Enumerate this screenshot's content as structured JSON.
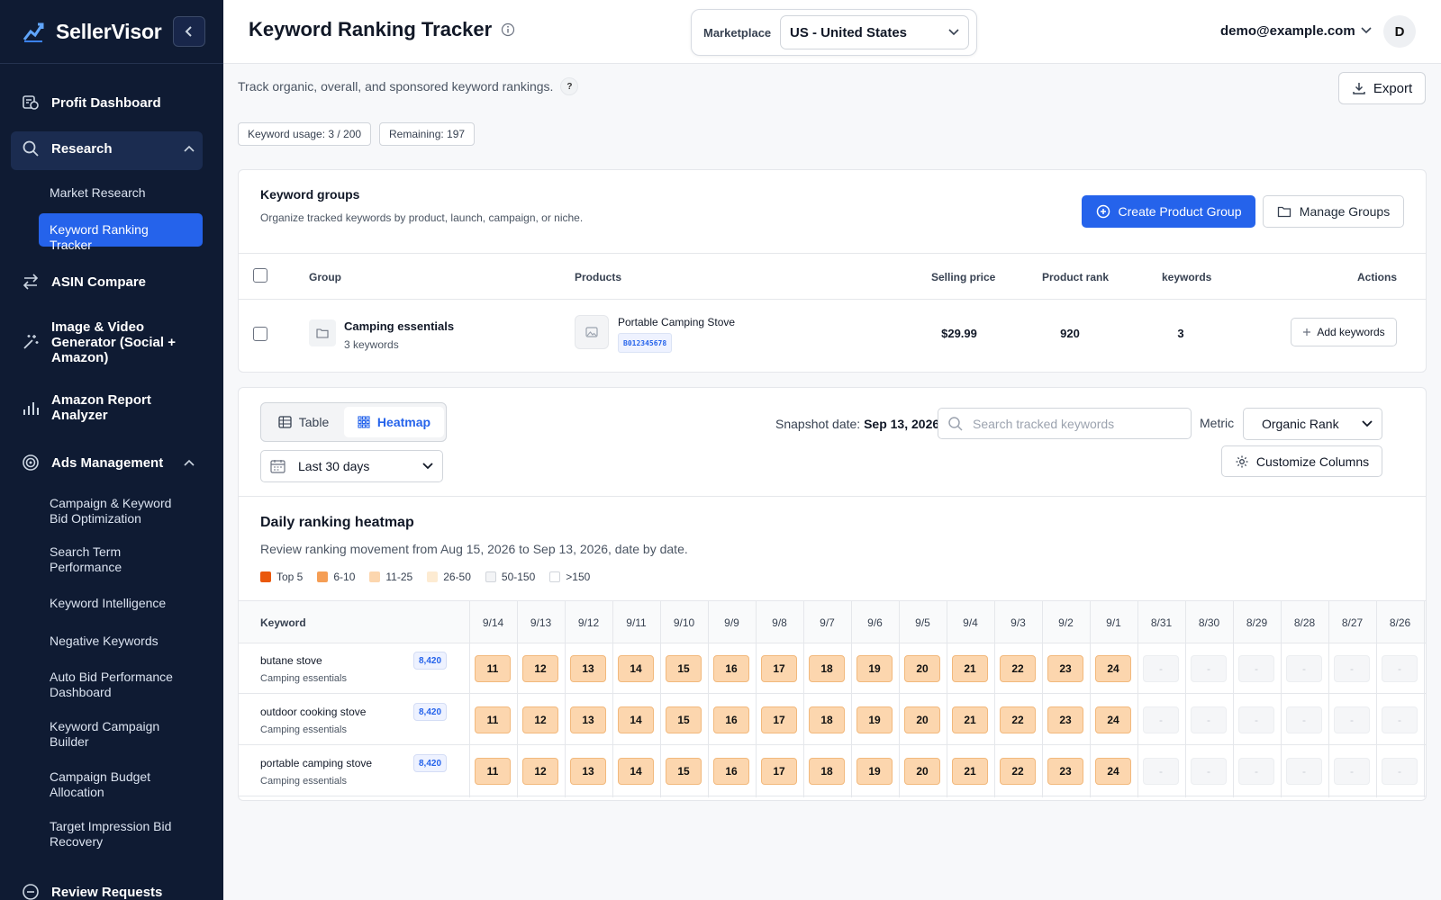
{
  "brand": {
    "name": "SellerVisor"
  },
  "sidebar": {
    "items": [
      {
        "label": "Profit Dashboard",
        "icon": "dollar-dashboard-icon"
      },
      {
        "label": "Research",
        "icon": "search-icon",
        "expanded": true
      },
      {
        "label": "Market Research",
        "sub": true
      },
      {
        "label": "Keyword Ranking Tracker",
        "sub": true,
        "active": true
      },
      {
        "label": "ASIN Compare",
        "icon": "arrows-compare-icon"
      },
      {
        "label": "Image & Video Generator (Social + Amazon)",
        "icon": "sparkle-icon"
      },
      {
        "label": "Amazon Report Analyzer",
        "icon": "bar-chart-icon"
      },
      {
        "label": "Ads Management",
        "icon": "target-icon",
        "expanded": true
      },
      {
        "label": "Campaign & Keyword Bid Optimization",
        "sub": true
      },
      {
        "label": "Search Term Performance",
        "sub": true
      },
      {
        "label": "Keyword Intelligence",
        "sub": true
      },
      {
        "label": "Negative Keywords",
        "sub": true
      },
      {
        "label": "Auto Bid Performance Dashboard",
        "sub": true
      },
      {
        "label": "Keyword Campaign Builder",
        "sub": true
      },
      {
        "label": "Campaign Budget Allocation",
        "sub": true
      },
      {
        "label": "Target Impression Bid Recovery",
        "sub": true
      },
      {
        "label": "Review Requests",
        "icon": "chat-icon"
      }
    ]
  },
  "header": {
    "title": "Keyword Ranking Tracker",
    "marketplace_label": "Marketplace",
    "marketplace_value": "US - United States",
    "user_email": "demo@example.com",
    "avatar_initial": "D"
  },
  "page": {
    "subtitle": "Track organic, overall, and sponsored keyword rankings.",
    "help": "?",
    "export_label": "Export",
    "usage_chip": "Keyword usage: 3 / 200",
    "remaining_chip": "Remaining: 197"
  },
  "groups": {
    "title": "Keyword groups",
    "description": "Organize tracked keywords by product, launch, campaign, or niche.",
    "create_label": "Create Product Group",
    "manage_label": "Manage Groups",
    "columns": {
      "group": "Group",
      "products": "Products",
      "price": "Selling price",
      "rank": "Product rank",
      "keywords": "keywords",
      "actions": "Actions"
    },
    "row": {
      "name": "Camping essentials",
      "count": "3 keywords",
      "product": "Portable Camping Stove",
      "asin": "B012345678",
      "price": "$29.99",
      "rank": "920",
      "keywords": "3",
      "action": "Add keywords"
    }
  },
  "heatmap": {
    "view_table": "Table",
    "view_heatmap": "Heatmap",
    "range": "Last 30 days",
    "snapshot_label": "Snapshot date:",
    "snapshot_value": "Sep 13, 2026",
    "search_placeholder": "Search tracked keywords",
    "metric_label": "Metric",
    "metric_value": "Organic Rank",
    "customize_label": "Customize Columns",
    "title": "Daily ranking heatmap",
    "description": "Review ranking movement from Aug 15, 2026 to Sep 13, 2026, date by date.",
    "legend": [
      {
        "label": "Top 5",
        "color": "#ea580c"
      },
      {
        "label": "6-10",
        "color": "#f59e55"
      },
      {
        "label": "11-25",
        "color": "#fcd6ae"
      },
      {
        "label": "26-50",
        "color": "#fdebd2"
      },
      {
        "label": "50-150",
        "color": "#f3f4f6"
      },
      {
        "label": ">150",
        "color": "#ffffff"
      }
    ],
    "keyword_col": "Keyword",
    "dates": [
      "9/14",
      "9/13",
      "9/12",
      "9/11",
      "9/10",
      "9/9",
      "9/8",
      "9/7",
      "9/6",
      "9/5",
      "9/4",
      "9/3",
      "9/2",
      "9/1",
      "8/31",
      "8/30",
      "8/29",
      "8/28",
      "8/27",
      "8/26"
    ],
    "rows": [
      {
        "keyword": "butane stove",
        "group": "Camping essentials",
        "volume": "8,420",
        "ranks": [
          "11",
          "12",
          "13",
          "14",
          "15",
          "16",
          "17",
          "18",
          "19",
          "20",
          "21",
          "22",
          "23",
          "24",
          "-",
          "-",
          "-",
          "-",
          "-",
          "-"
        ]
      },
      {
        "keyword": "outdoor cooking stove",
        "group": "Camping essentials",
        "volume": "8,420",
        "ranks": [
          "11",
          "12",
          "13",
          "14",
          "15",
          "16",
          "17",
          "18",
          "19",
          "20",
          "21",
          "22",
          "23",
          "24",
          "-",
          "-",
          "-",
          "-",
          "-",
          "-"
        ]
      },
      {
        "keyword": "portable camping stove",
        "group": "Camping essentials",
        "volume": "8,420",
        "ranks": [
          "11",
          "12",
          "13",
          "14",
          "15",
          "16",
          "17",
          "18",
          "19",
          "20",
          "21",
          "22",
          "23",
          "24",
          "-",
          "-",
          "-",
          "-",
          "-",
          "-"
        ]
      }
    ]
  },
  "colors": {
    "sidebar_bg": "#0f1b33",
    "accent": "#2563eb",
    "heat_cell": "#fcd6ae"
  }
}
